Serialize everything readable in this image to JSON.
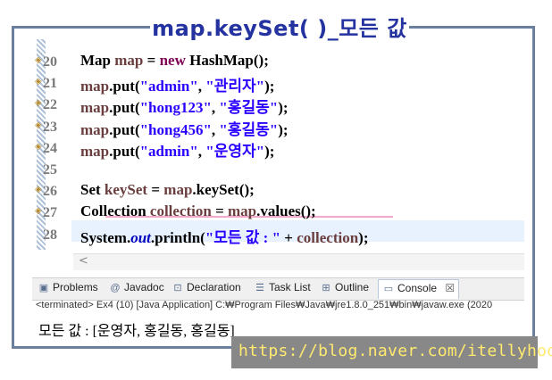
{
  "title": "map.keySet( )_모든 값",
  "editor": {
    "lines": [
      {
        "num": "20",
        "code": [
          {
            "t": "Map ",
            "c": ""
          },
          {
            "t": "map",
            "c": "var"
          },
          {
            "t": " = ",
            "c": ""
          },
          {
            "t": "new",
            "c": "kw"
          },
          {
            "t": " HashMap();",
            "c": ""
          }
        ]
      },
      {
        "num": "21",
        "code": [
          {
            "t": "map",
            "c": "var"
          },
          {
            "t": ".put(",
            "c": ""
          },
          {
            "t": "\"admin\"",
            "c": "str"
          },
          {
            "t": ", ",
            "c": ""
          },
          {
            "t": "\"관리자\"",
            "c": "str"
          },
          {
            "t": ");",
            "c": ""
          }
        ]
      },
      {
        "num": "22",
        "code": [
          {
            "t": "map",
            "c": "var"
          },
          {
            "t": ".put(",
            "c": ""
          },
          {
            "t": "\"hong123\"",
            "c": "str"
          },
          {
            "t": ", ",
            "c": ""
          },
          {
            "t": "\"홍길동\"",
            "c": "str"
          },
          {
            "t": ");",
            "c": ""
          }
        ]
      },
      {
        "num": "23",
        "code": [
          {
            "t": "map",
            "c": "var"
          },
          {
            "t": ".put(",
            "c": ""
          },
          {
            "t": "\"hong456\"",
            "c": "str"
          },
          {
            "t": ", ",
            "c": ""
          },
          {
            "t": "\"홍길동\"",
            "c": "str"
          },
          {
            "t": ");",
            "c": ""
          }
        ]
      },
      {
        "num": "24",
        "code": [
          {
            "t": "map",
            "c": "var"
          },
          {
            "t": ".put(",
            "c": ""
          },
          {
            "t": "\"admin\"",
            "c": "str"
          },
          {
            "t": ", ",
            "c": ""
          },
          {
            "t": "\"운영자\"",
            "c": "str"
          },
          {
            "t": ");",
            "c": ""
          }
        ]
      },
      {
        "num": "25",
        "code": []
      },
      {
        "num": "26",
        "code": [
          {
            "t": "Set ",
            "c": ""
          },
          {
            "t": "keySet",
            "c": "var"
          },
          {
            "t": " = ",
            "c": ""
          },
          {
            "t": "map",
            "c": "var"
          },
          {
            "t": ".keySet();",
            "c": ""
          }
        ]
      },
      {
        "num": "27",
        "code": [
          {
            "t": "Collection ",
            "c": ""
          },
          {
            "t": "collection",
            "c": "var"
          },
          {
            "t": " = ",
            "c": ""
          },
          {
            "t": "map",
            "c": "var"
          },
          {
            "t": ".values();",
            "c": ""
          }
        ]
      },
      {
        "num": "28",
        "code": [
          {
            "t": "System.",
            "c": ""
          },
          {
            "t": "out",
            "c": "fld"
          },
          {
            "t": ".println(",
            "c": ""
          },
          {
            "t": "\"모든 값 : \"",
            "c": "str"
          },
          {
            "t": " + ",
            "c": ""
          },
          {
            "t": "collection",
            "c": "var"
          },
          {
            "t": ");",
            "c": ""
          }
        ]
      }
    ]
  },
  "scroll_left_arrow": "<",
  "tabs": {
    "problems": "Problems",
    "javadoc": "Javadoc",
    "declaration": "Declaration",
    "tasklist": "Task List",
    "outline": "Outline",
    "console": "Console",
    "close": "☒"
  },
  "console": {
    "header": "<terminated> Ex4 (10) [Java Application] C:₩Program Files₩Java₩jre1.8.0_251₩bin₩javaw.exe  (2020",
    "output": "모든 값 : [운영자, 홍길동, 홍길동]"
  },
  "watermark": "https://blog.naver.com/itellyhood",
  "colors": {
    "frame": "#6b7f9f",
    "title": "#2433a0",
    "keyword": "#7f0055",
    "string": "#2a00ff",
    "watermark": "#ffea70"
  }
}
